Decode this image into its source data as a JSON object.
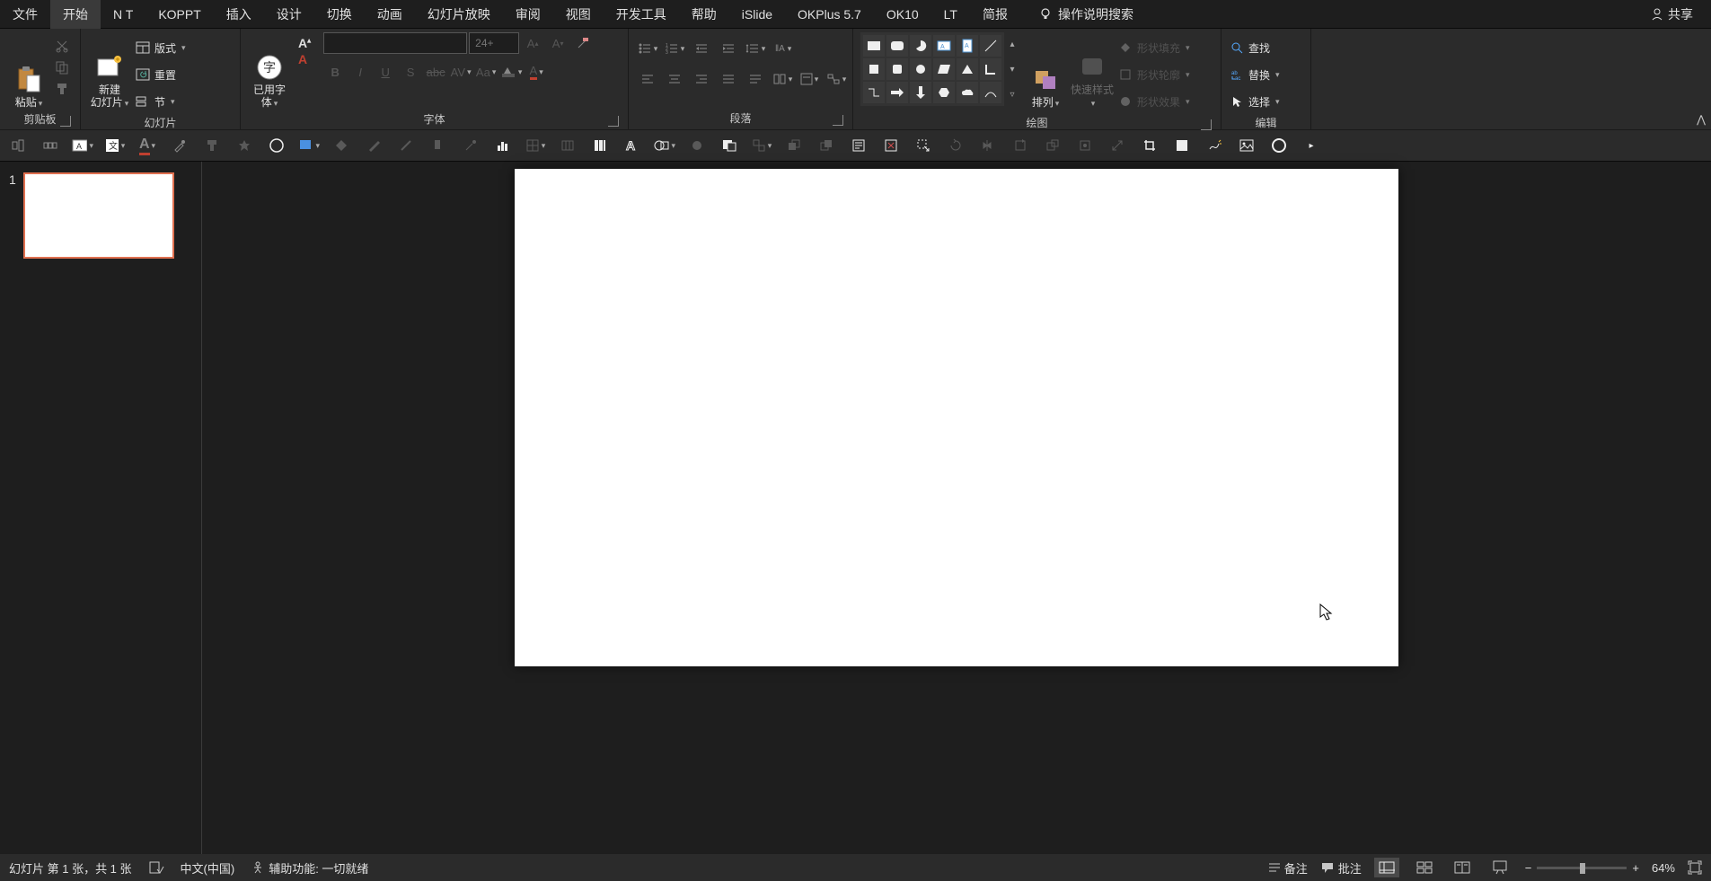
{
  "tabs": {
    "file": "文件",
    "home": "开始",
    "nt": "N T",
    "koppt": "KOPPT",
    "insert": "插入",
    "design": "设计",
    "transition": "切换",
    "animation": "动画",
    "slideshow": "幻灯片放映",
    "review": "审阅",
    "view": "视图",
    "devtools": "开发工具",
    "help": "帮助",
    "islide": "iSlide",
    "okplus": "OKPlus 5.7",
    "ok10": "OK10",
    "lt": "LT",
    "brief": "简报"
  },
  "search_label": "操作说明搜索",
  "share_label": "共享",
  "ribbon": {
    "clipboard": {
      "label": "剪贴板",
      "paste": "粘贴"
    },
    "slides": {
      "label": "幻灯片",
      "new_slide": "新建\n幻灯片",
      "layout": "版式",
      "reset": "重置",
      "section": "节"
    },
    "font_group": {
      "label": "字体",
      "used_font": "已用字\n体",
      "size_placeholder": "24+"
    },
    "paragraph": {
      "label": "段落"
    },
    "drawing": {
      "label": "绘图",
      "arrange": "排列",
      "quick_styles": "快速样式",
      "shape_fill": "形状填充",
      "shape_outline": "形状轮廓",
      "shape_effects": "形状效果"
    },
    "editing": {
      "label": "编辑",
      "find": "查找",
      "replace": "替换",
      "select": "选择"
    }
  },
  "thumb": {
    "num": "1"
  },
  "status": {
    "slide_info": "幻灯片 第 1 张，共 1 张",
    "language": "中文(中国)",
    "accessibility": "辅助功能: 一切就绪",
    "notes": "备注",
    "comments": "批注",
    "zoom": "64%"
  }
}
